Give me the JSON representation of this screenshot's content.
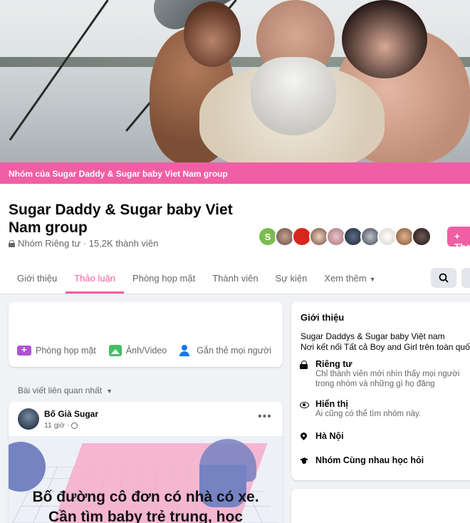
{
  "cover": {
    "alt_icon": "cover-photo"
  },
  "banner": {
    "label": "Nhóm của Sugar Daddy & Sugar baby Viet Nam group"
  },
  "group": {
    "title": "Sugar Daddy & Sugar baby Viet Nam group",
    "meta": "Nhóm Riêng tư · 15,2K thành viên",
    "avatar_initial": "S",
    "join_label": "+ Tham gia nhóm"
  },
  "tabs": [
    {
      "label": "Giới thiệu"
    },
    {
      "label": "Thảo luận",
      "active": true
    },
    {
      "label": "Phòng họp mặt"
    },
    {
      "label": "Thành viên"
    },
    {
      "label": "Sự kiện"
    },
    {
      "label": "Xem thêm"
    }
  ],
  "composer": {
    "actions": [
      {
        "label": "Phòng họp mặt",
        "icon": "video-room-icon"
      },
      {
        "label": "Ảnh/Video",
        "icon": "photo-icon"
      },
      {
        "label": "Gắn thẻ mọi người",
        "icon": "tag-people-icon"
      }
    ]
  },
  "sort": {
    "label": "Bài viết liên quan nhất"
  },
  "post": {
    "author": "Bố Già Sugar",
    "time": "11 giờ ·",
    "caption_line1": "Bố đường cô đơn có nhà có xe.",
    "caption_line2": "Cần tìm baby trẻ trung, học"
  },
  "about": {
    "title": "Giới thiệu",
    "desc_line1": "Sugar Daddys & Sugar baby Việt nam",
    "desc_line2": "Nơi kết nối Tất cả Boy and Girl trên toàn quốc",
    "private_title": "Riêng tư",
    "private_desc": "Chỉ thành viên mới nhìn thấy mọi người trong nhóm và những gì họ đăng",
    "visible_title": "Hiển thị",
    "visible_desc": "Ai cũng có thể tìm nhóm này.",
    "location": "Hà Nội",
    "category": "Nhóm Cùng nhau học hỏi"
  },
  "colors": {
    "accent": "#f05fa4",
    "link_blue": "#1877f2"
  }
}
